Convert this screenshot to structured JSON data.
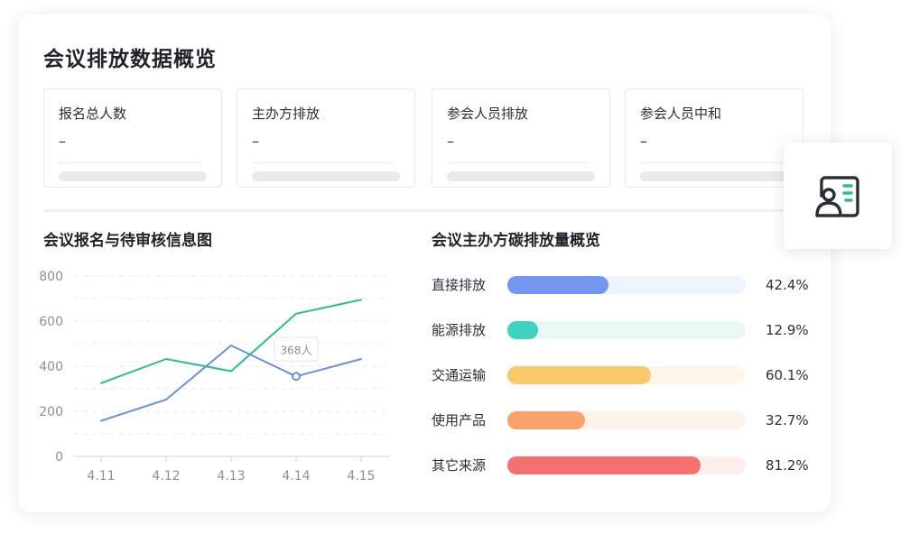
{
  "page": {
    "title": "会议排放数据概览"
  },
  "stats": [
    {
      "label": "报名总人数",
      "value": "–"
    },
    {
      "label": "主办方排放",
      "value": "–"
    },
    {
      "label": "参会人员排放",
      "value": "–"
    },
    {
      "label": "参会人员中和",
      "value": "–"
    }
  ],
  "line_chart": {
    "title": "会议报名与待审核信息图",
    "tooltip": "368人"
  },
  "bar_chart": {
    "title": "会议主办方碳排放量概览",
    "items": [
      {
        "label": "直接排放",
        "value": "42.4%",
        "fraction": 0.424,
        "color": "#7396f0",
        "track": "#eef3fd"
      },
      {
        "label": "能源排放",
        "value": "12.9%",
        "fraction": 0.129,
        "color": "#3ed3be",
        "track": "#e8f8f5"
      },
      {
        "label": "交通运输",
        "value": "60.1%",
        "fraction": 0.601,
        "color": "#f9c96b",
        "track": "#fff8ea"
      },
      {
        "label": "使用产品",
        "value": "32.7%",
        "fraction": 0.327,
        "color": "#f9a36a",
        "track": "#fdf2ec"
      },
      {
        "label": "其它来源",
        "value": "81.2%",
        "fraction": 0.812,
        "color": "#f57171",
        "track": "#fdeeee"
      }
    ]
  },
  "chart_data": {
    "type": "line",
    "title": "会议报名与待审核信息图",
    "x": [
      "4.11",
      "4.12",
      "4.13",
      "4.14",
      "4.15"
    ],
    "yticks": [
      "0",
      "200",
      "400",
      "600",
      "800"
    ],
    "ylim": [
      0,
      800
    ],
    "series": [
      {
        "values": [
          325,
          432,
          378,
          633,
          695
        ],
        "color": "#2bbd8e"
      },
      {
        "values": [
          158,
          252,
          492,
          355,
          432
        ],
        "color": "#6e8ee0"
      }
    ],
    "annotation": {
      "series": 1,
      "index": 3,
      "text": "368人"
    },
    "grid": true,
    "legend": "none"
  },
  "colors": {
    "line_green": "#2bbd8e",
    "line_blue": "#6e8ee0",
    "icon_dark": "#2b2f36",
    "icon_accent": "#2bbd8e"
  },
  "icons": {
    "float_card": "contact-card-icon"
  }
}
